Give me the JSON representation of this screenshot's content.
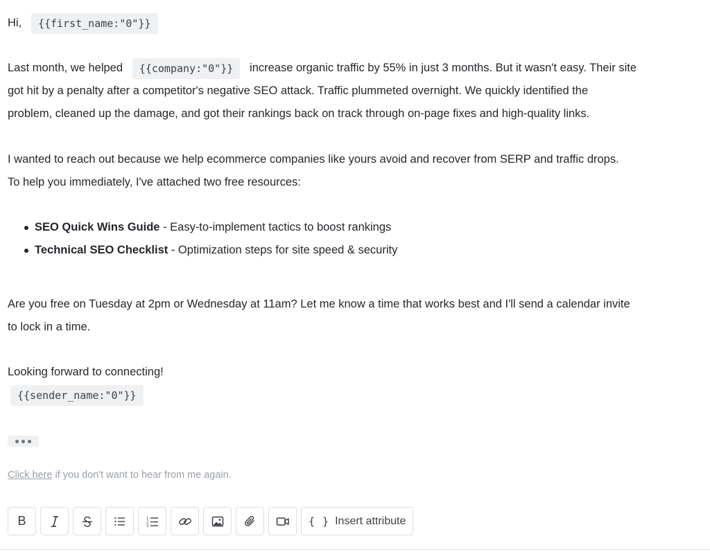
{
  "email": {
    "greeting": "Hi,",
    "greeting_var": "{{first_name:\"0\"}}",
    "p1_line1_a": "Last month, we helped",
    "p1_var": "{{company:\"0\"}}",
    "p1_line1_b": "increase organic traffic by 55% in just 3 months. But it wasn't easy. Their site",
    "p1_line2": "got hit by a penalty after a competitor's negative SEO attack. Traffic plummeted overnight. We quickly identified the",
    "p1_line3": "problem, cleaned up the damage, and got their rankings back on track through on-page fixes and high-quality links.",
    "p2_line1": "I wanted to reach out because we help ecommerce companies like yours avoid and recover from SERP and traffic drops.",
    "p2_line2": "To help you immediately, I've attached two free resources:",
    "resources": [
      {
        "title": "SEO Quick Wins Guide",
        "desc": " - Easy-to-implement tactics to boost rankings"
      },
      {
        "title": "Technical SEO Checklist",
        "desc": " - Optimization steps for site speed & security"
      }
    ],
    "p3_line1": "Are you free on Tuesday at 2pm or Wednesday at 11am? Let me know a time that works best and I'll send a calendar invite",
    "p3_line2": "to lock in a time.",
    "closing": "Looking forward to connecting!",
    "sender_var": "{{sender_name:\"0\"}}",
    "unsubscribe_link": "Click here",
    "unsubscribe_text": " if you don't want to hear from me again."
  },
  "toolbar": {
    "bold_label": "B",
    "italic_label": "I",
    "insert_attribute_braces": "{ }",
    "insert_attribute_label": "Insert attribute",
    "icons": [
      "bold-icon",
      "italic-icon",
      "strikethrough-icon",
      "bulleted-list-icon",
      "numbered-list-icon",
      "link-icon",
      "image-icon",
      "attachment-icon",
      "video-icon",
      "braces-icon"
    ]
  },
  "colors": {
    "text": "#24272b",
    "variable_bg": "#eef0f2",
    "muted": "#9aa0a6",
    "border": "#dadde1"
  }
}
